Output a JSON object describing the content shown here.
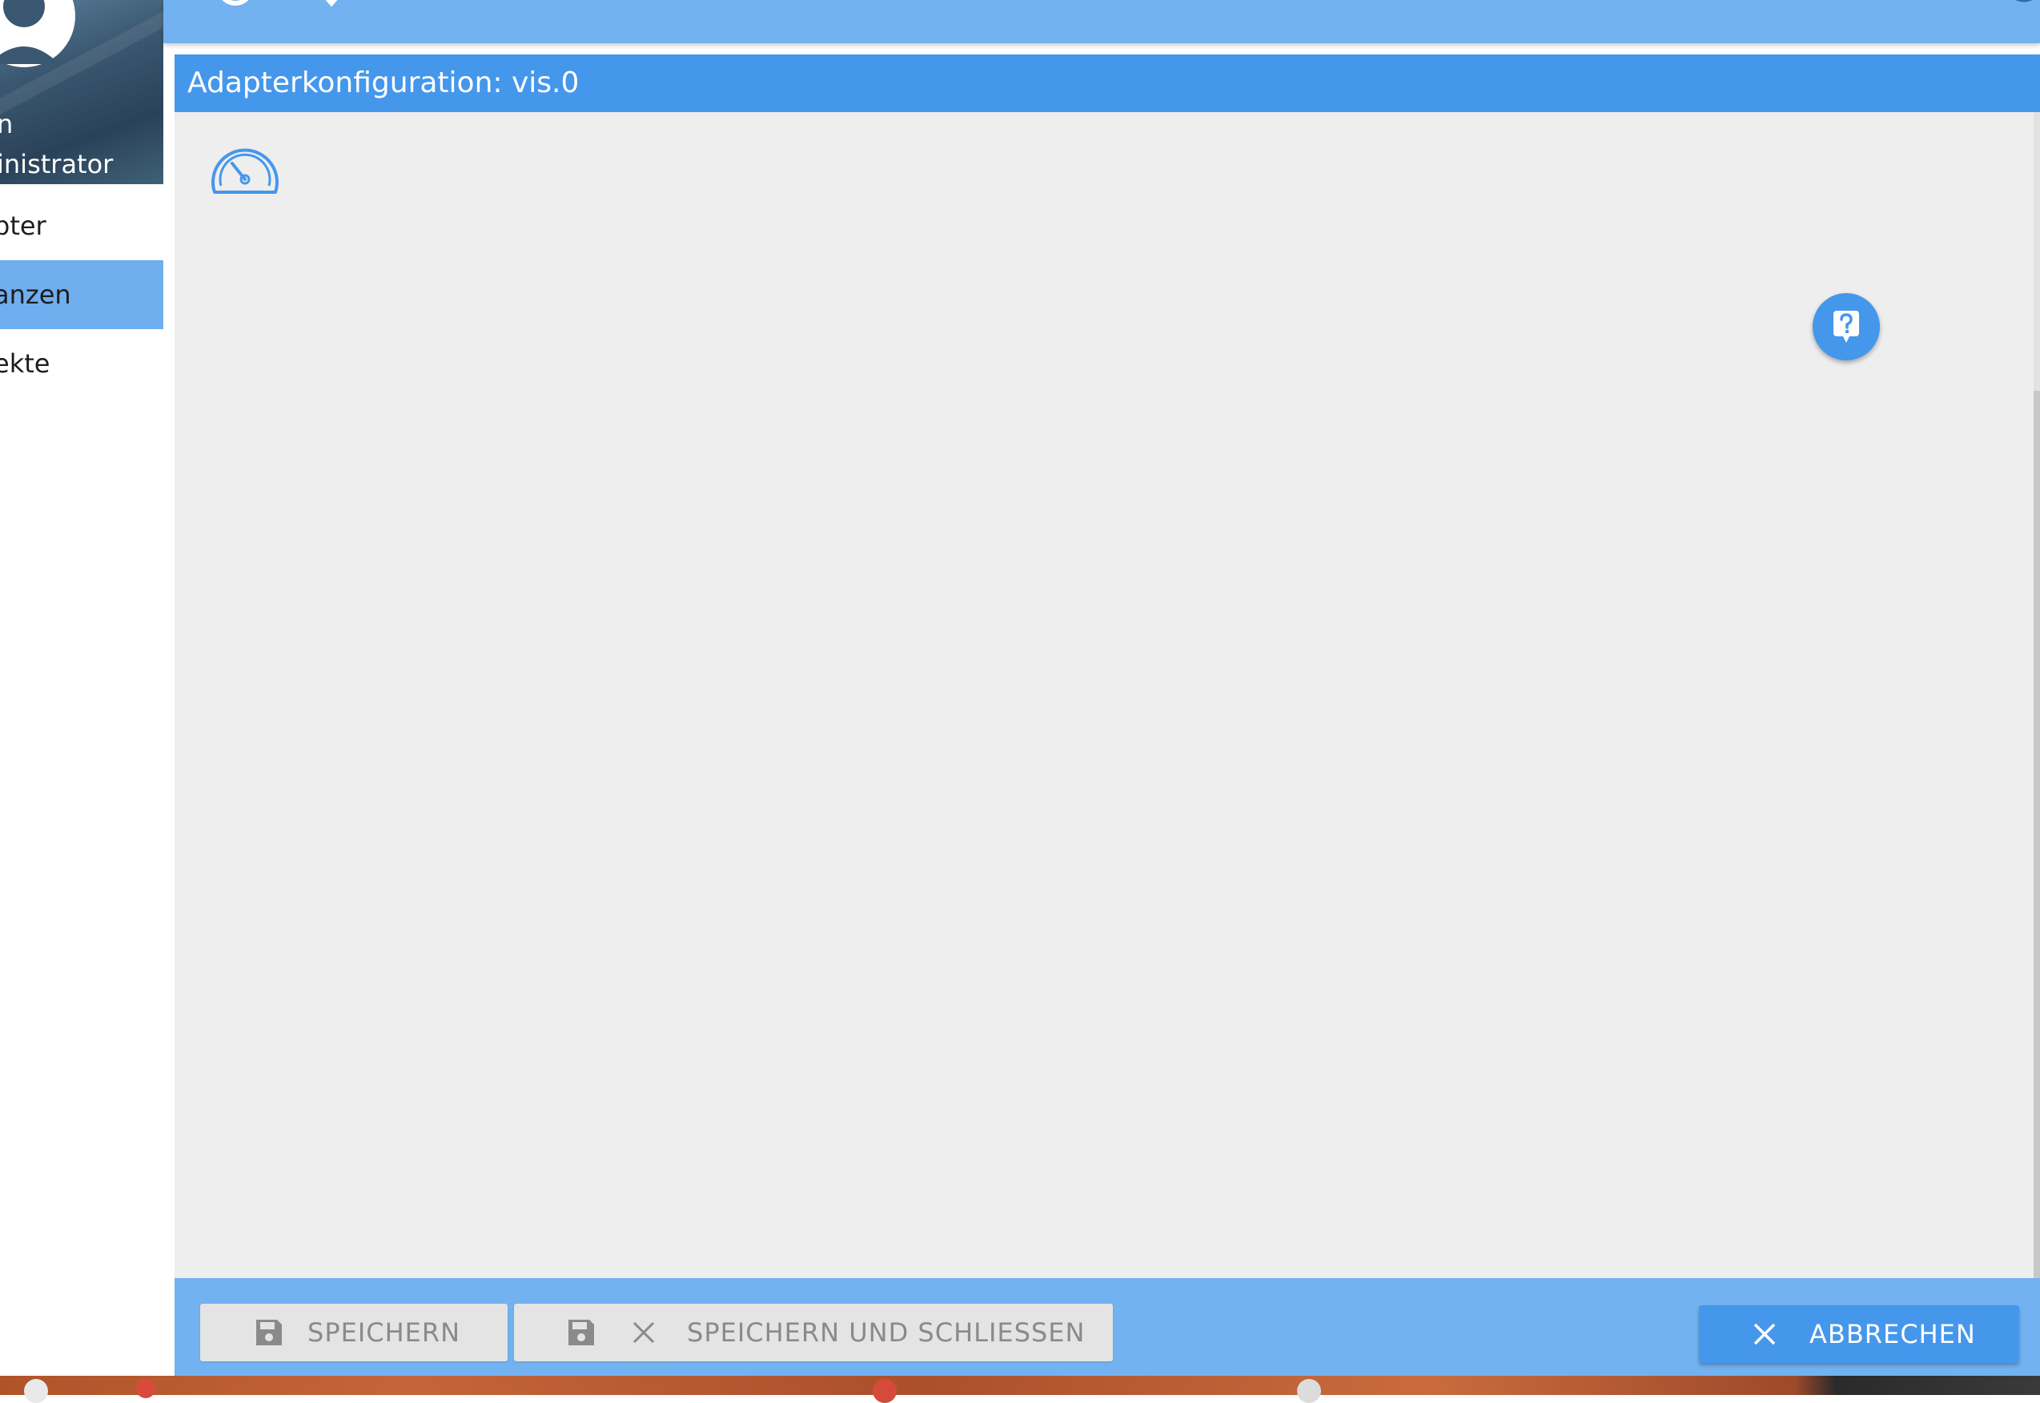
{
  "sidebar": {
    "profile": {
      "line1": "n",
      "line2": "inistrator"
    },
    "items": [
      {
        "label": "pter",
        "active": false
      },
      {
        "label": "anzen",
        "active": true
      },
      {
        "label": "ekte",
        "active": false
      }
    ]
  },
  "dialog": {
    "title": "Adapterkonfiguration: vis.0"
  },
  "footer": {
    "save_label": "SPEICHERN",
    "save_close_label": "SPEICHERN UND SCHLIESSEN",
    "cancel_label": "ABBRECHEN"
  },
  "colors": {
    "accent": "#4597ec",
    "topbar": "#73b2f0",
    "content_bg": "#eeeeee"
  }
}
